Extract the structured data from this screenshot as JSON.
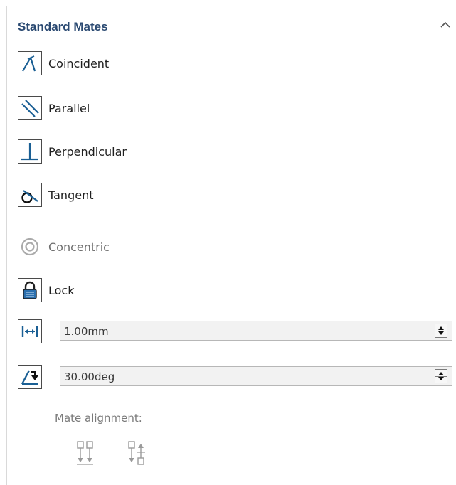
{
  "section": {
    "title": "Standard Mates",
    "collapse_icon": "chevron-up-icon"
  },
  "mates": [
    {
      "label": "Coincident",
      "icon": "coincident-icon",
      "enabled": true
    },
    {
      "label": "Parallel",
      "icon": "parallel-icon",
      "enabled": true
    },
    {
      "label": "Perpendicular",
      "icon": "perpendicular-icon",
      "enabled": true
    },
    {
      "label": "Tangent",
      "icon": "tangent-icon",
      "enabled": true
    },
    {
      "label": "Concentric",
      "icon": "concentric-icon",
      "enabled": false
    },
    {
      "label": "Lock",
      "icon": "lock-icon",
      "enabled": true
    }
  ],
  "distance": {
    "value": "1.00mm",
    "icon": "distance-icon"
  },
  "angle": {
    "value": "30.00deg",
    "icon": "angle-icon"
  },
  "alignment": {
    "label": "Mate alignment:",
    "buttons": [
      "aligned-icon",
      "anti-aligned-icon"
    ]
  },
  "colors": {
    "title": "#2b4a72",
    "icon": "#1a5f94",
    "disabled": "#7a7a7a"
  }
}
